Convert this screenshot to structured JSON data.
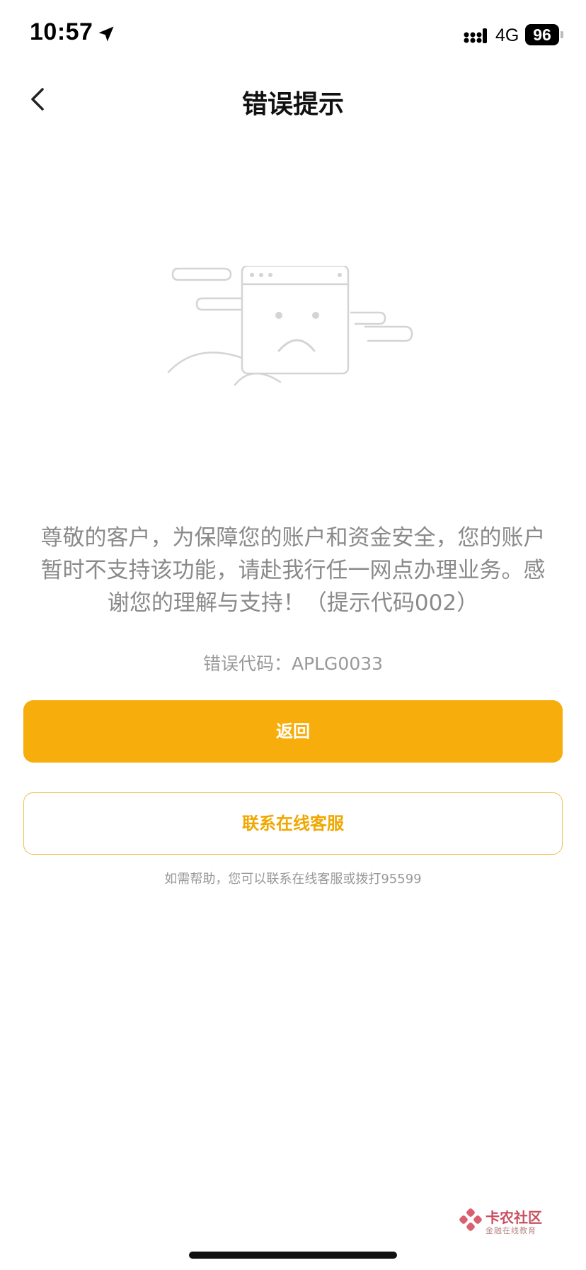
{
  "status_bar": {
    "time": "10:57",
    "network": "4G",
    "battery": "96"
  },
  "nav": {
    "title": "错误提示"
  },
  "message": {
    "lines": [
      "尊敬的客户，为保障您的账户和资金安全，您的账户",
      "暂时不支持该功能，请赴我行任一网点办理业务。感",
      "谢您的理解与支持！（提示代码002）"
    ]
  },
  "error": {
    "label": "错误代码：",
    "code": "APLG0033"
  },
  "buttons": {
    "back_label": "返回",
    "contact_label": "联系在线客服"
  },
  "help_text": "如需帮助，您可以联系在线客服或拨打95599",
  "watermark": {
    "title": "卡农社区",
    "subtitle": "金融在线教育"
  },
  "colors": {
    "accent": "#f7ad0b",
    "accent_text": "#f0a800",
    "muted_text": "#8a8a8a"
  }
}
